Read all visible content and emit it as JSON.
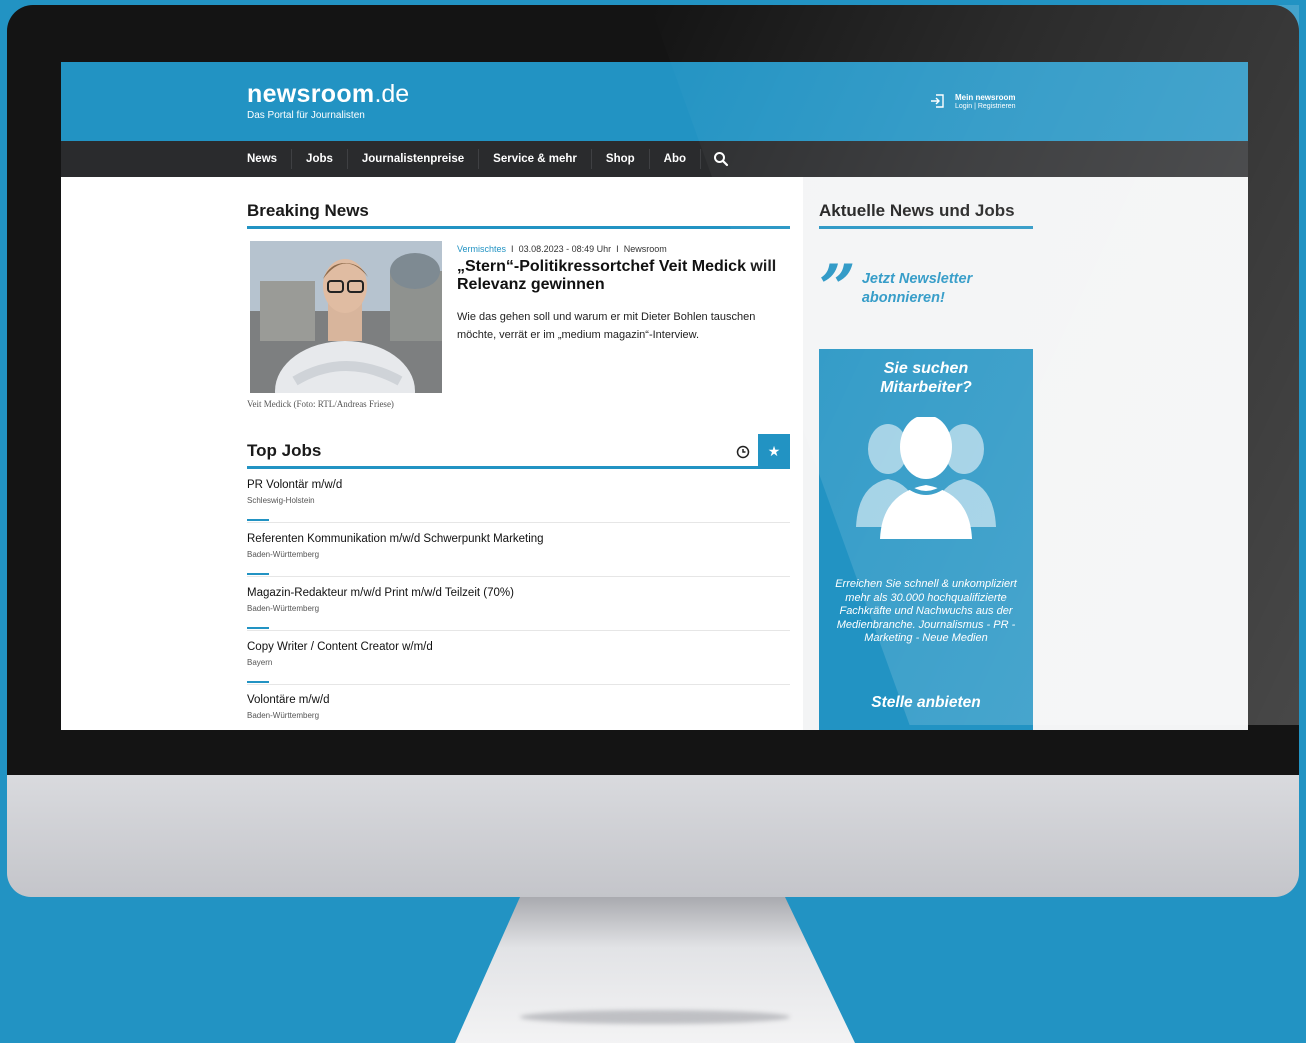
{
  "site": {
    "logo_main": "newsroom",
    "logo_tld": ".de",
    "tagline": "Das Portal für Journalisten"
  },
  "account": {
    "title": "Mein newsroom",
    "links": "Login | Registrieren",
    "icon": "login-icon"
  },
  "nav": {
    "items": [
      "News",
      "Jobs",
      "Journalistenpreise",
      "Service & mehr",
      "Shop",
      "Abo"
    ],
    "search_icon": "search-icon"
  },
  "breaking": {
    "title": "Breaking News",
    "category": "Vermischtes",
    "separator": "I",
    "date": "03.08.2023 - 08:49 Uhr",
    "source": "Newsroom",
    "headline": "„Stern“-Politikressortchef Veit Medick will Relevanz gewinnen",
    "teaser": "Wie das gehen soll und warum er mit Dieter Bohlen tauschen möchte, verrät er im „medium magazin“-Interview.",
    "caption": "Veit Medick (Foto: RTL/Andreas Friese)"
  },
  "jobs": {
    "title": "Top Jobs",
    "clock_icon": "clock-icon",
    "star_icon": "star-icon",
    "items": [
      {
        "title": "PR Volontär m/w/d",
        "region": "Schleswig-Holstein"
      },
      {
        "title": "Referenten Kommunikation m/w/d Schwerpunkt Marketing",
        "region": "Baden-Württemberg"
      },
      {
        "title": "Magazin-Redakteur m/w/d Print m/w/d Teilzeit (70%)",
        "region": "Baden-Württemberg"
      },
      {
        "title": "Copy Writer / Content Creator w/m/d",
        "region": "Bayern"
      },
      {
        "title": "Volontäre m/w/d",
        "region": "Baden-Württemberg"
      }
    ]
  },
  "sidebar": {
    "title": "Aktuelle News und Jobs",
    "newsletter_line1": "Jetzt Newsletter",
    "newsletter_line2": "abonnieren!",
    "ad_title_line1": "Sie suchen",
    "ad_title_line2": "Mitarbeiter?",
    "ad_text": "Erreichen Sie schnell & unkompliziert mehr als 30.000 hochqualifizierte Fachkräfte und Nachwuchs aus der Medienbranche. Journalismus - PR - Marketing - Neue Medien",
    "ad_cta": "Stelle anbieten",
    "ad_icon": "people-icon"
  },
  "colors": {
    "brand": "#2293c3",
    "nav": "#2a2b2d"
  }
}
